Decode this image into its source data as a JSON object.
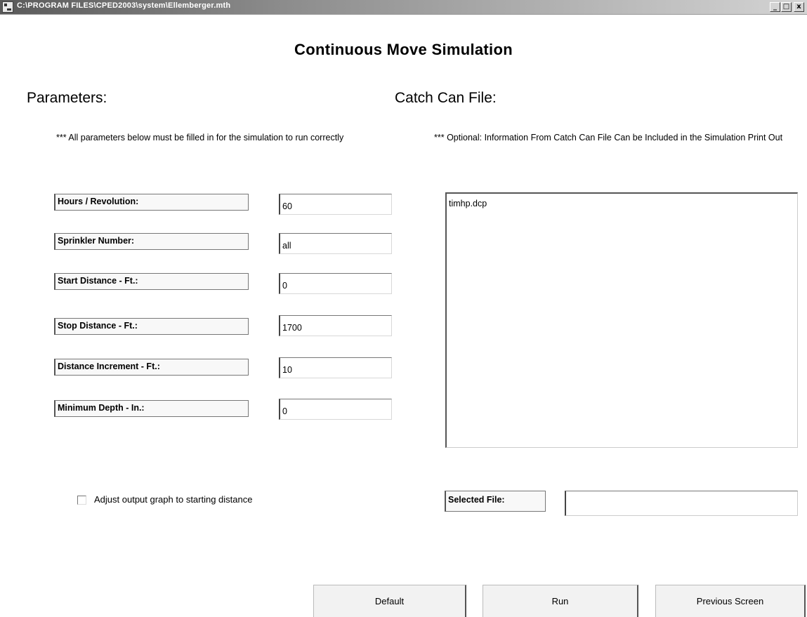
{
  "window": {
    "title": "C:\\PROGRAM FILES\\CPED2003\\system\\Ellemberger.mth",
    "controls": {
      "minimize": "_",
      "maximize": "□",
      "close": "x"
    }
  },
  "page": {
    "title": "Continuous Move Simulation"
  },
  "parameters": {
    "heading": "Parameters:",
    "note": "*** All parameters below must be filled in for the simulation to run correctly",
    "fields": [
      {
        "label": "Hours / Revolution:",
        "value": "60"
      },
      {
        "label": "Sprinkler Number:",
        "value": "all"
      },
      {
        "label": "Start Distance - Ft.:",
        "value": "0"
      },
      {
        "label": "Stop Distance - Ft.:",
        "value": "1700"
      },
      {
        "label": "Distance Increment - Ft.:",
        "value": "10"
      },
      {
        "label": "Minimum Depth - In.:",
        "value": "0"
      }
    ],
    "adjust_checkbox": {
      "label": "Adjust output graph to starting distance",
      "checked": false
    }
  },
  "catch_can": {
    "heading": "Catch Can File:",
    "note": "*** Optional: Information From Catch Can File Can be Included in the Simulation Print Out",
    "files": [
      "timhp.dcp"
    ],
    "selected_label": "Selected File:",
    "selected_value": ""
  },
  "buttons": {
    "default": "Default",
    "run": "Run",
    "previous": "Previous Screen"
  },
  "icons": {
    "app": "app-window-icon",
    "checkbox": "checkbox-unchecked-icon"
  }
}
